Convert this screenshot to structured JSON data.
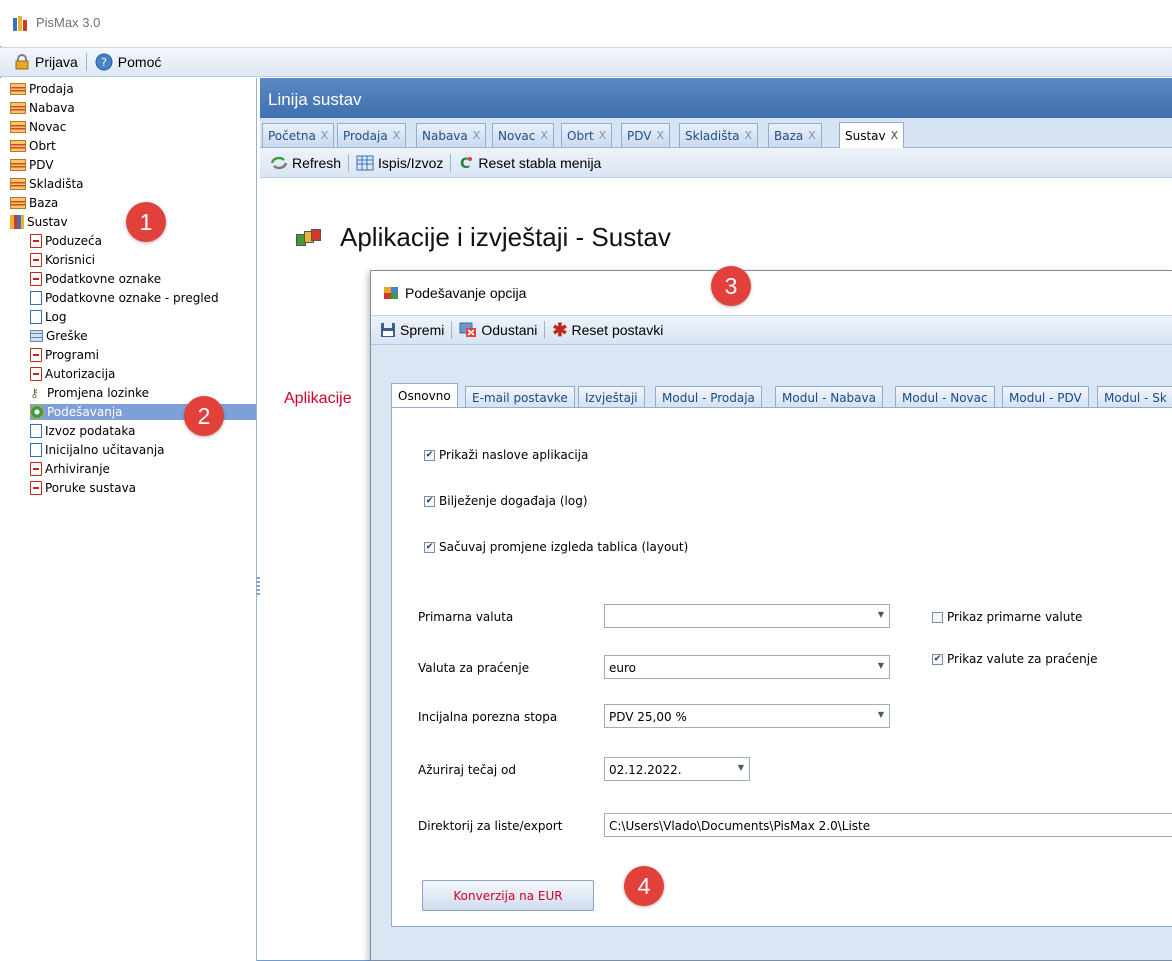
{
  "window": {
    "title": "PisMax 3.0"
  },
  "menubar": {
    "items": [
      {
        "label": "Prijava",
        "icon": "lock-icon"
      },
      {
        "label": "Pomoć",
        "icon": "help-icon"
      }
    ]
  },
  "sidebar": {
    "items": [
      {
        "label": "Prodaja",
        "icon": "folder-icon"
      },
      {
        "label": "Nabava",
        "icon": "folder-icon"
      },
      {
        "label": "Novac",
        "icon": "folder-icon"
      },
      {
        "label": "Obrt",
        "icon": "folder-icon"
      },
      {
        "label": "PDV",
        "icon": "folder-icon"
      },
      {
        "label": "Skladišta",
        "icon": "folder-icon"
      },
      {
        "label": "Baza",
        "icon": "folder-icon"
      },
      {
        "label": "Sustav",
        "icon": "books-icon"
      },
      {
        "label": "Poduzeća",
        "icon": "document-icon"
      },
      {
        "label": "Korisnici",
        "icon": "document-icon"
      },
      {
        "label": "Podatkovne oznake",
        "icon": "document-icon"
      },
      {
        "label": "Podatkovne oznake - pregled",
        "icon": "blank-document-icon"
      },
      {
        "label": "Log",
        "icon": "log-icon"
      },
      {
        "label": "Greške",
        "icon": "grid-icon"
      },
      {
        "label": "Programi",
        "icon": "document-icon"
      },
      {
        "label": "Autorizacija",
        "icon": "document-icon"
      },
      {
        "label": "Promjena lozinke",
        "icon": "key-icon"
      },
      {
        "label": "Podešavanja",
        "icon": "settings-icon",
        "selected": true
      },
      {
        "label": "Izvoz podataka",
        "icon": "blank-document-icon"
      },
      {
        "label": "Inicijalno učitavanja",
        "icon": "blank-document-icon"
      },
      {
        "label": "Arhiviranje",
        "icon": "document-icon"
      },
      {
        "label": "Poruke sustava",
        "icon": "document-icon"
      }
    ]
  },
  "main": {
    "header": "Linija sustav",
    "tabs": [
      {
        "label": "Početna"
      },
      {
        "label": "Prodaja"
      },
      {
        "label": "Nabava"
      },
      {
        "label": "Novac"
      },
      {
        "label": "Obrt"
      },
      {
        "label": "PDV"
      },
      {
        "label": "Skladišta"
      },
      {
        "label": "Baza"
      },
      {
        "label": "Sustav",
        "active": true
      }
    ],
    "tab_close": "X",
    "toolbar": {
      "refresh": "Refresh",
      "print_export": "Ispis/Izvoz",
      "reset_menu": "Reset stabla menija"
    },
    "page_title": "Aplikacije i izvještaji - Sustav",
    "section_label": "Aplikacije"
  },
  "dialog": {
    "title": "Podešavanje opcija",
    "toolbar": {
      "save": "Spremi",
      "cancel": "Odustani",
      "reset": "Reset postavki"
    },
    "tabs": [
      {
        "label": "Osnovno",
        "active": true
      },
      {
        "label": "E-mail postavke"
      },
      {
        "label": "Izvještaji"
      },
      {
        "label": "Modul - Prodaja"
      },
      {
        "label": "Modul - Nabava"
      },
      {
        "label": "Modul - Novac"
      },
      {
        "label": "Modul - PDV"
      },
      {
        "label": "Modul - Sk"
      }
    ],
    "checkboxes": {
      "show_titles": {
        "label": "Prikaži naslove aplikacija",
        "checked": true
      },
      "log_events": {
        "label": "Bilježenje događaja (log)",
        "checked": true
      },
      "save_layout": {
        "label": "Sačuvaj promjene izgleda tablica (layout)",
        "checked": true
      },
      "show_primary": {
        "label": "Prikaz primarne valute",
        "checked": false
      },
      "show_tracking": {
        "label": "Prikaz valute za praćenje",
        "checked": true
      }
    },
    "fields": {
      "primary_currency": {
        "label": "Primarna valuta",
        "value": ""
      },
      "tracking_currency": {
        "label": "Valuta za praćenje",
        "value": "euro"
      },
      "initial_tax": {
        "label": "Incijalna porezna stopa",
        "value": "PDV 25,00 %"
      },
      "update_rate": {
        "label": "Ažuriraj tečaj od",
        "value": "02.12.2022."
      },
      "export_dir": {
        "label": "Direktorij za liste/export",
        "value": "C:\\Users\\Vlado\\Documents\\PisMax 2.0\\Liste"
      }
    },
    "convert_button": "Konverzija na EUR"
  },
  "callouts": [
    "1",
    "2",
    "3",
    "4"
  ],
  "colors": {
    "accent": "#3f6fae",
    "callout": "#e2403a",
    "selected": "#7f9fd8",
    "warning_text": "#d3002a"
  }
}
